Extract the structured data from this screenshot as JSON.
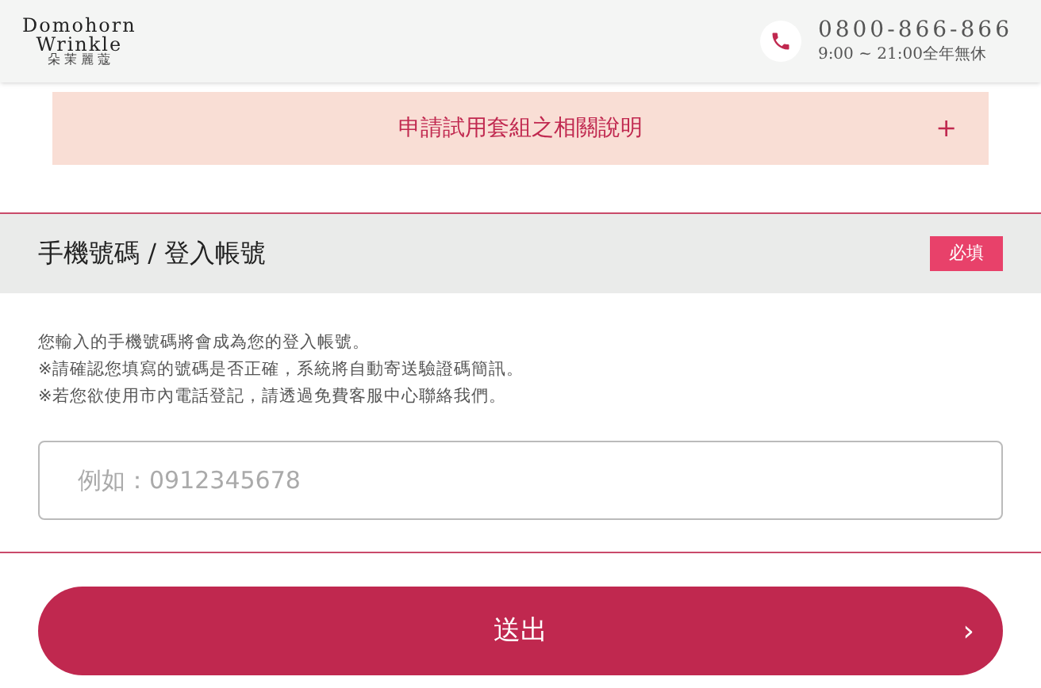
{
  "header": {
    "logo_lines": [
      "Domohorn",
      "Wrinkle",
      "朵 茉 麗 蔻"
    ],
    "phone": "0800-866-866",
    "hours": "9:00 ~ 21:00全年無休"
  },
  "accordion": {
    "title": "申請試用套組之相關說明",
    "toggle": "+",
    "expanded": false
  },
  "section": {
    "title": "手機號碼 / 登入帳號",
    "badge": "必填",
    "notes": [
      "您輸入的手機號碼將會成為您的登入帳號。",
      "※請確認您填寫的號碼是否正確，系統將自動寄送驗證碼簡訊。",
      "※若您欲使用市內電話登記，請透過免費客服中心聯絡我們。"
    ],
    "field": {
      "placeholder": "例如：0912345678"
    }
  },
  "submit": {
    "label": "送出",
    "arrow": "›"
  }
}
